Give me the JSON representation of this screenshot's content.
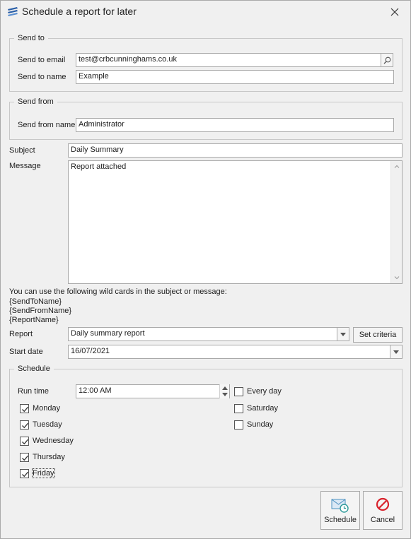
{
  "window": {
    "title": "Schedule a report for later"
  },
  "send_to": {
    "legend": "Send to",
    "email_label": "Send to email",
    "email_value": "test@crbcunninghams.co.uk",
    "name_label": "Send to name",
    "name_value": "Example"
  },
  "send_from": {
    "legend": "Send from",
    "name_label": "Send from name",
    "name_value": "Administrator"
  },
  "subject": {
    "label": "Subject",
    "value": "Daily Summary"
  },
  "message": {
    "label": "Message",
    "value": "Report attached"
  },
  "wildcards": {
    "intro": "You can use the following wild cards in the subject or message:",
    "items": [
      "{SendToName}",
      "{SendFromName}",
      "{ReportName}"
    ]
  },
  "report": {
    "label": "Report",
    "value": "Daily summary report",
    "criteria_button": "Set criteria"
  },
  "start_date": {
    "label": "Start date",
    "value": "16/07/2021"
  },
  "schedule": {
    "legend": "Schedule",
    "run_time_label": "Run time",
    "run_time_value": "12:00 AM",
    "days": [
      {
        "label": "Monday",
        "checked": true
      },
      {
        "label": "Tuesday",
        "checked": true
      },
      {
        "label": "Wednesday",
        "checked": true
      },
      {
        "label": "Thursday",
        "checked": true
      },
      {
        "label": "Friday",
        "checked": true
      },
      {
        "label": "Every day",
        "checked": false
      },
      {
        "label": "Saturday",
        "checked": false
      },
      {
        "label": "Sunday",
        "checked": false
      }
    ]
  },
  "buttons": {
    "schedule": "Schedule",
    "cancel": "Cancel"
  },
  "icons": {
    "app": "report-icon",
    "close": "close-icon",
    "lookup": "search-icon",
    "dropdown": "chevron-down-icon",
    "schedule": "envelope-clock-icon",
    "cancel": "cancel-circle-icon"
  },
  "colors": {
    "cancel_icon": "#d9232d",
    "schedule_icon": "#4a8fbf",
    "clock": "#2e9a9a"
  }
}
